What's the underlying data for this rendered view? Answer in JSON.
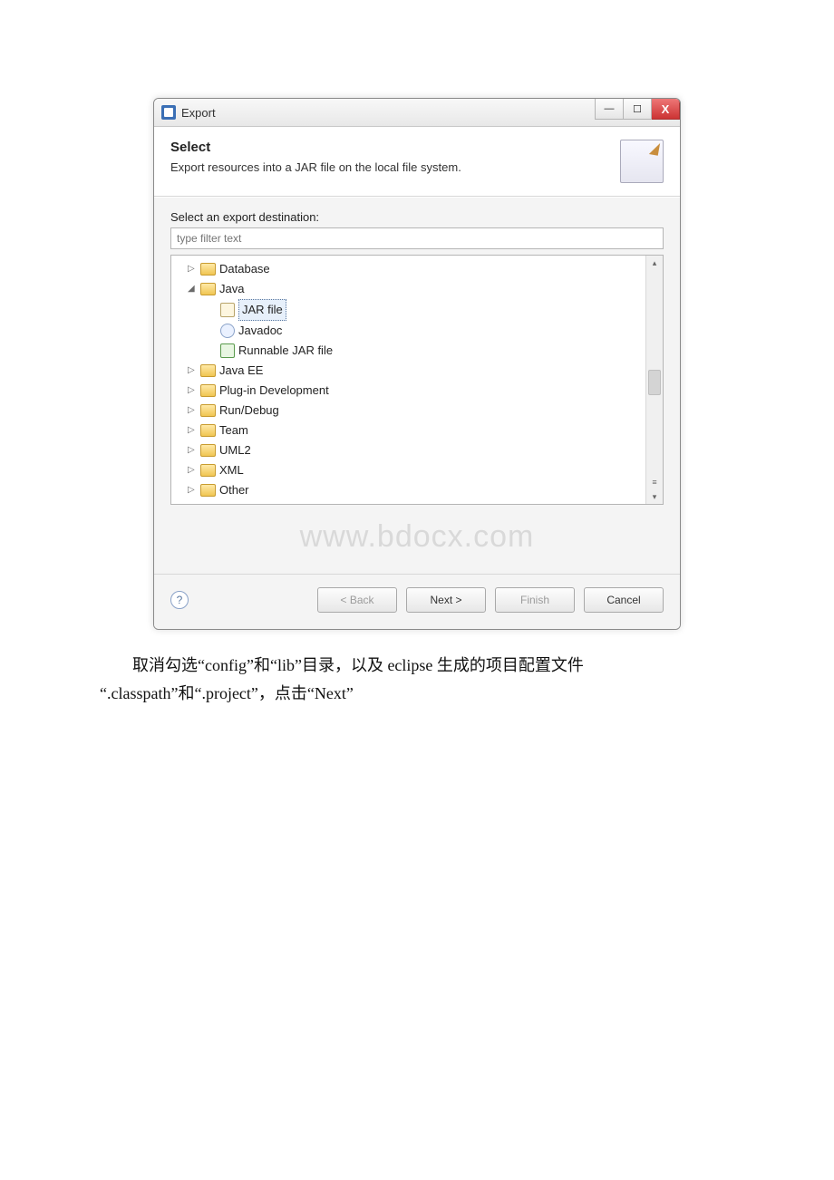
{
  "window": {
    "title": "Export",
    "min_glyph": "—",
    "max_glyph": "☐",
    "close_glyph": "X"
  },
  "banner": {
    "title": "Select",
    "description": "Export resources into a JAR file on the local file system."
  },
  "body": {
    "label": "Select an export destination:",
    "filter_placeholder": "type filter text"
  },
  "tree": {
    "items": [
      {
        "expander": "▷",
        "type": "folder",
        "label": "Database",
        "child": false,
        "selected": false
      },
      {
        "expander": "◢",
        "type": "folder",
        "label": "Java",
        "child": false,
        "selected": false
      },
      {
        "expander": "",
        "type": "leaf",
        "label": "JAR file",
        "child": true,
        "selected": true,
        "icon": "plain"
      },
      {
        "expander": "",
        "type": "leaf",
        "label": "Javadoc",
        "child": true,
        "selected": false,
        "icon": "javadoc"
      },
      {
        "expander": "",
        "type": "leaf",
        "label": "Runnable JAR file",
        "child": true,
        "selected": false,
        "icon": "green"
      },
      {
        "expander": "▷",
        "type": "folder",
        "label": "Java EE",
        "child": false,
        "selected": false
      },
      {
        "expander": "▷",
        "type": "folder",
        "label": "Plug-in Development",
        "child": false,
        "selected": false
      },
      {
        "expander": "▷",
        "type": "folder",
        "label": "Run/Debug",
        "child": false,
        "selected": false
      },
      {
        "expander": "▷",
        "type": "folder",
        "label": "Team",
        "child": false,
        "selected": false
      },
      {
        "expander": "▷",
        "type": "folder",
        "label": "UML2",
        "child": false,
        "selected": false
      },
      {
        "expander": "▷",
        "type": "folder",
        "label": "XML",
        "child": false,
        "selected": false
      },
      {
        "expander": "▷",
        "type": "folder",
        "label": "Other",
        "child": false,
        "selected": false
      }
    ],
    "scroll_up": "▴",
    "scroll_down": "▾",
    "scroll_mid": "≡"
  },
  "watermark": "www.bdocx.com",
  "footer": {
    "help": "?",
    "back": "< Back",
    "next": "Next >",
    "finish": "Finish",
    "cancel": "Cancel"
  },
  "caption": {
    "line1": "取消勾选“config”和“lib”目录，以及 eclipse 生成的项目配置文件",
    "line2": "“.classpath”和“.project”，点击“Next”"
  }
}
